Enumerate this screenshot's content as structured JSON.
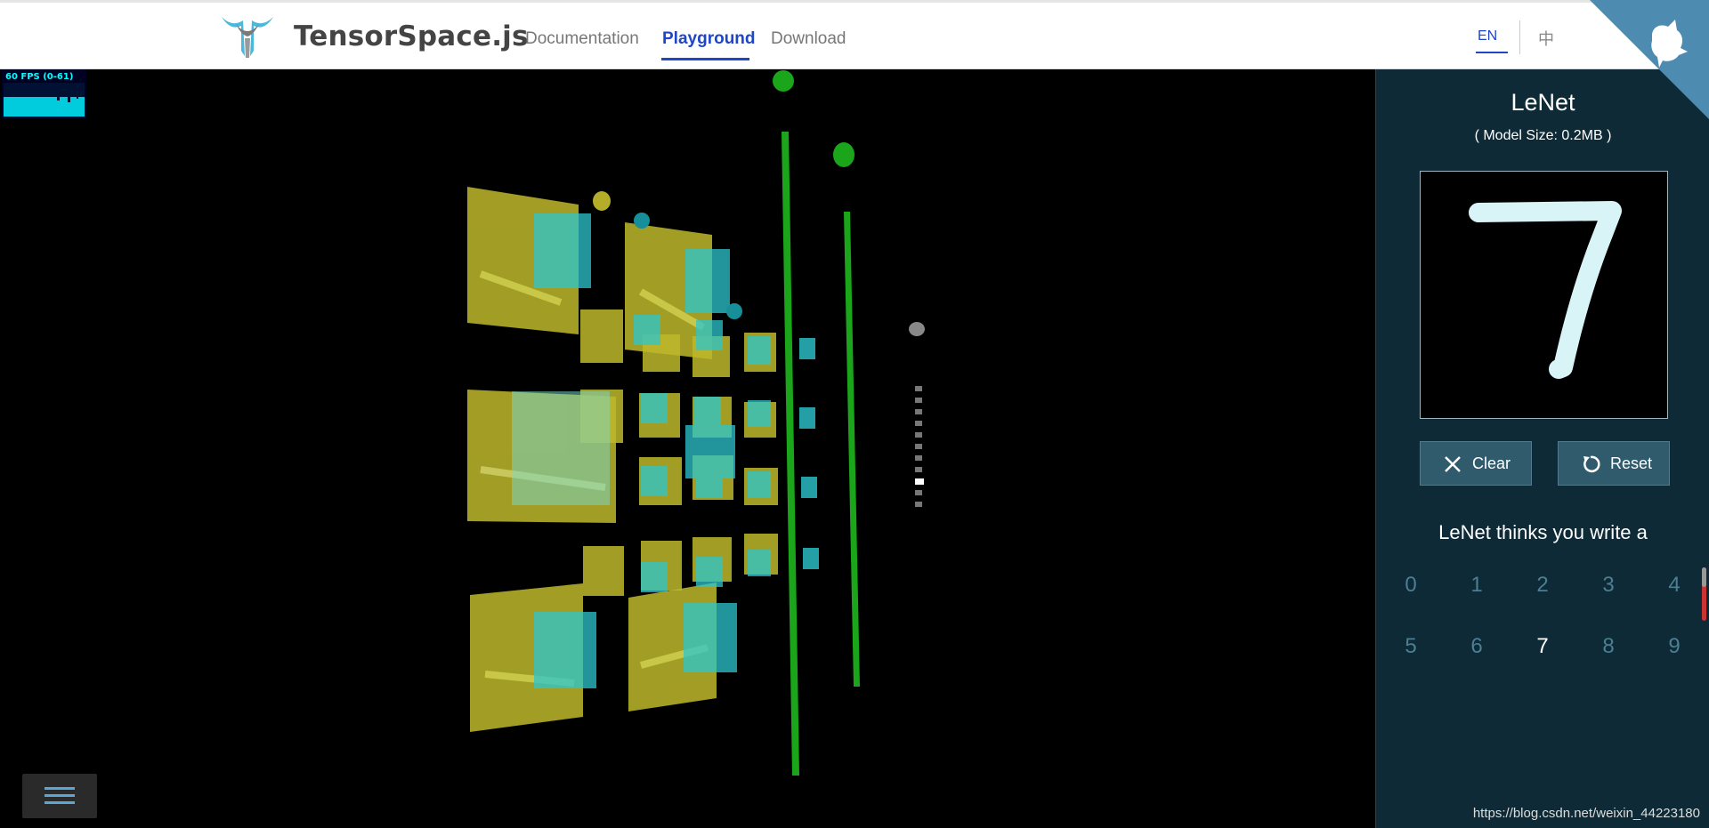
{
  "header": {
    "brand": "TensorSpace.js",
    "nav": [
      {
        "label": "Documentation"
      },
      {
        "label": "Playground"
      },
      {
        "label": "Download"
      }
    ],
    "lang_en": "EN",
    "lang_zh": "中"
  },
  "canvas": {
    "fps_label": "60 FPS (0-61)"
  },
  "panel": {
    "model_name": "LeNet",
    "model_size": "( Model Size: 0.2MB )",
    "clear_label": "Clear",
    "reset_label": "Reset",
    "thinks_text": "LeNet thinks you write a",
    "digits": [
      "0",
      "1",
      "2",
      "3",
      "4",
      "5",
      "6",
      "7",
      "8",
      "9"
    ],
    "selected_digit": "7"
  },
  "watermark": "https://blog.csdn.net/weixin_44223180",
  "colors": {
    "accent": "#1f46c7",
    "panel_bg": "#0d2a36",
    "feature_yellow": "#c8c23a",
    "feature_cyan": "#2fd0d8",
    "dense_green": "#1fb81f"
  }
}
